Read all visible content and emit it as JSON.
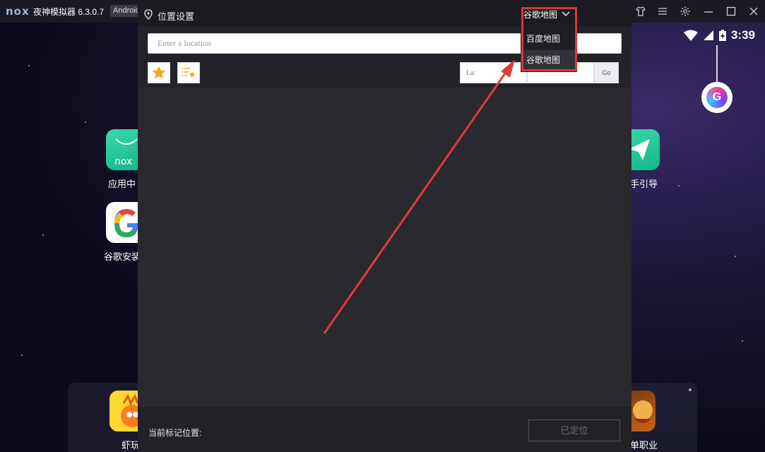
{
  "emulator": {
    "logo": "nox",
    "app_name": "夜神模拟器 6.3.0.7",
    "android_badge": "Android"
  },
  "status_bar": {
    "time": "3:39"
  },
  "desktop_apps": {
    "app1_label": "应用中",
    "app2_label": "谷歌安装",
    "app3_label": "手引导",
    "dock_app1_label": "虾玩",
    "dock_app2_label": "单职业"
  },
  "dialog": {
    "title": "位置设置",
    "search_placeholder": "Enter a location",
    "lat_placeholder": "Lat",
    "go_label": "Go",
    "footer_label": "当前标记位置:",
    "located_button": "已定位"
  },
  "map_provider": {
    "selected": "谷歌地图",
    "options": [
      "百度地图",
      "谷歌地图"
    ],
    "active_index": 1
  },
  "colors": {
    "highlight": "#e0323a",
    "favorite_star": "#f5a623"
  }
}
